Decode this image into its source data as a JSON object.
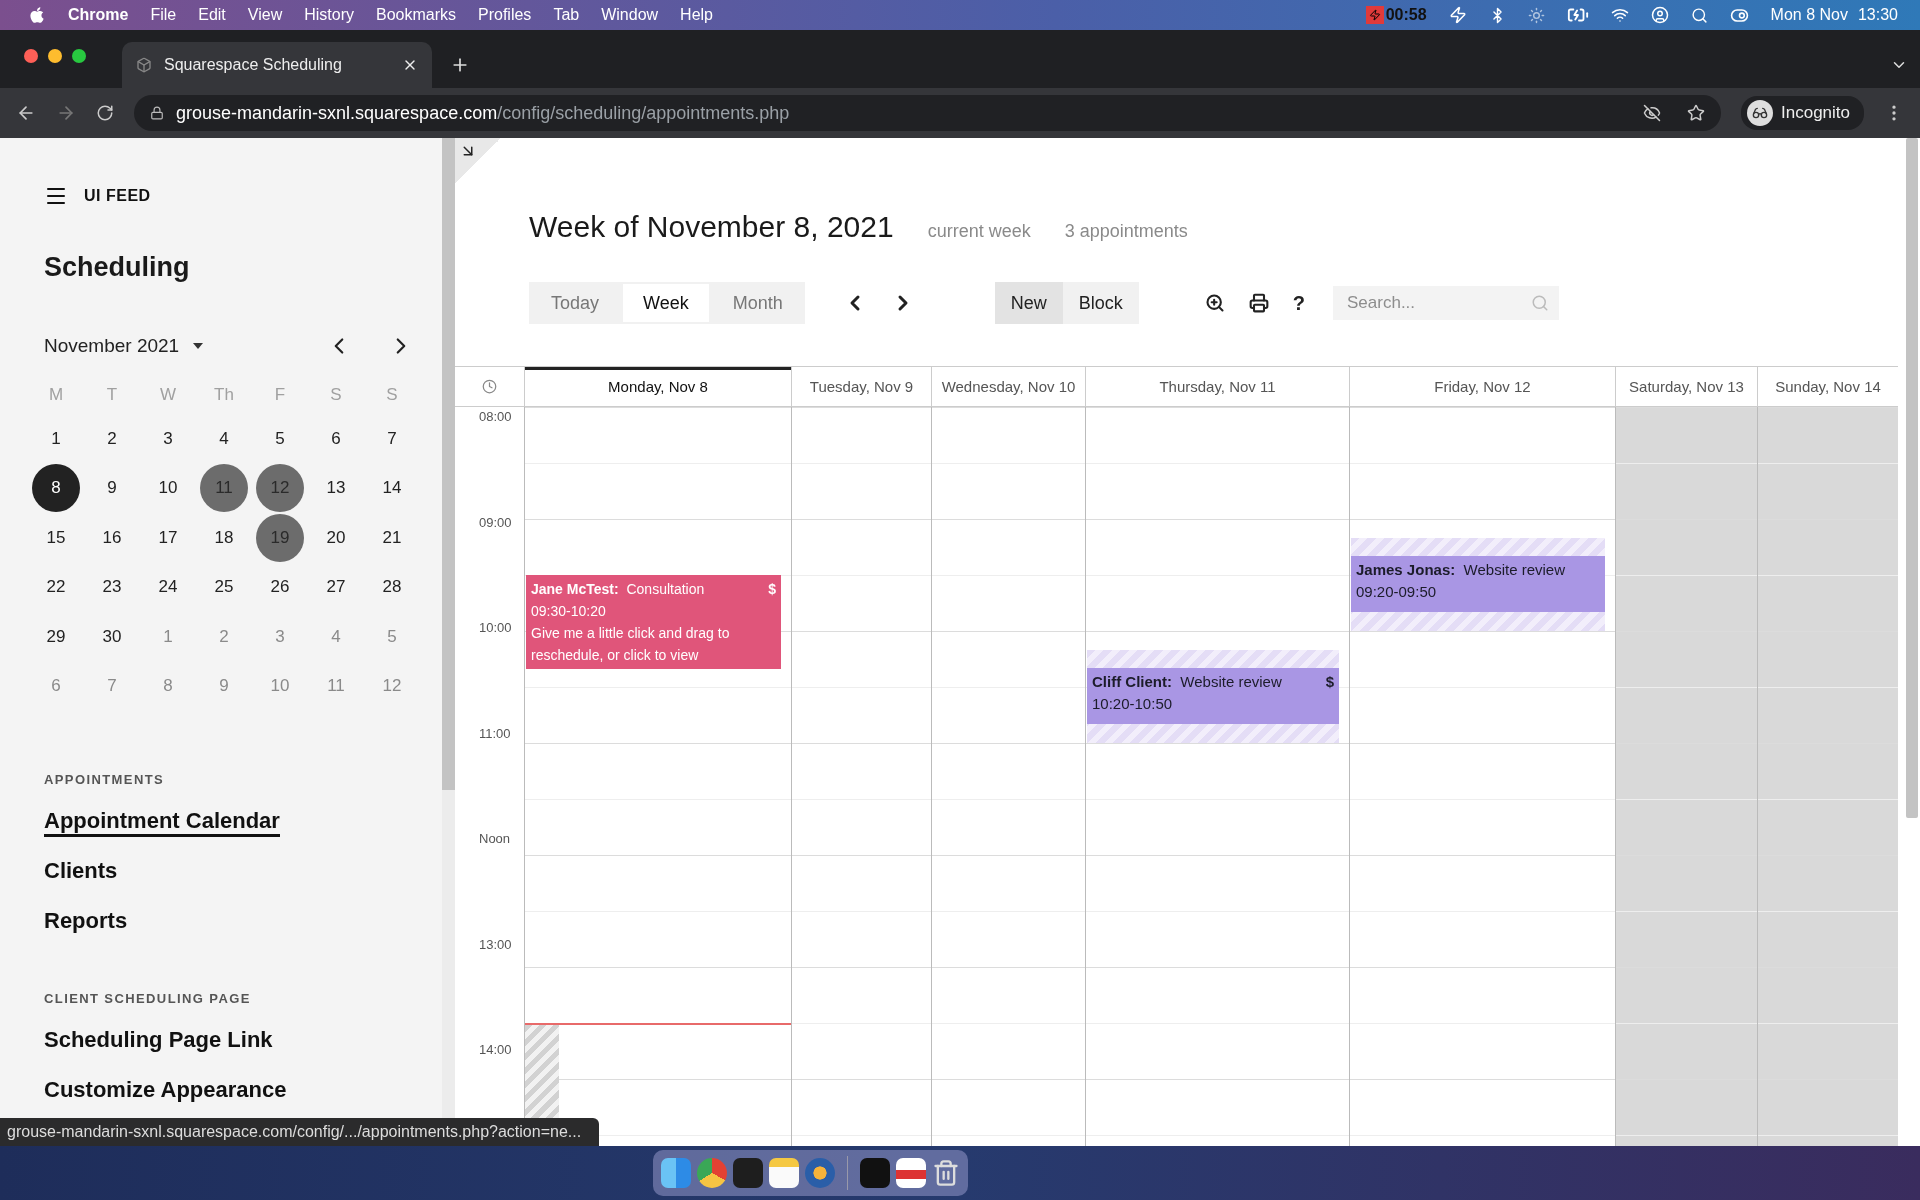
{
  "menubar": {
    "app": "Chrome",
    "menus": [
      "File",
      "Edit",
      "View",
      "History",
      "Bookmarks",
      "Profiles",
      "Tab",
      "Window",
      "Help"
    ],
    "timer": "00:58",
    "date": "Mon 8 Nov",
    "time": "13:30"
  },
  "browser": {
    "tab_title": "Squarespace Scheduling",
    "url_host": "grouse-mandarin-sxnl.squarespace.com",
    "url_path": "/config/scheduling/appointments.php",
    "profile": "Incognito"
  },
  "sidebar": {
    "brand": "UI FEED",
    "title": "Scheduling",
    "month": "November 2021",
    "weekdays": [
      "M",
      "T",
      "W",
      "Th",
      "F",
      "S",
      "S"
    ],
    "days": [
      {
        "label": "1",
        "outside": false,
        "selected": false,
        "marked": false
      },
      {
        "label": "2",
        "outside": false,
        "selected": false,
        "marked": false
      },
      {
        "label": "3",
        "outside": false,
        "selected": false,
        "marked": false
      },
      {
        "label": "4",
        "outside": false,
        "selected": false,
        "marked": false
      },
      {
        "label": "5",
        "outside": false,
        "selected": false,
        "marked": false
      },
      {
        "label": "6",
        "outside": false,
        "selected": false,
        "marked": false
      },
      {
        "label": "7",
        "outside": false,
        "selected": false,
        "marked": false
      },
      {
        "label": "8",
        "outside": false,
        "selected": true,
        "marked": false
      },
      {
        "label": "9",
        "outside": false,
        "selected": false,
        "marked": false
      },
      {
        "label": "10",
        "outside": false,
        "selected": false,
        "marked": false
      },
      {
        "label": "11",
        "outside": false,
        "selected": false,
        "marked": true
      },
      {
        "label": "12",
        "outside": false,
        "selected": false,
        "marked": true
      },
      {
        "label": "13",
        "outside": false,
        "selected": false,
        "marked": false
      },
      {
        "label": "14",
        "outside": false,
        "selected": false,
        "marked": false
      },
      {
        "label": "15",
        "outside": false,
        "selected": false,
        "marked": false
      },
      {
        "label": "16",
        "outside": false,
        "selected": false,
        "marked": false
      },
      {
        "label": "17",
        "outside": false,
        "selected": false,
        "marked": false
      },
      {
        "label": "18",
        "outside": false,
        "selected": false,
        "marked": false
      },
      {
        "label": "19",
        "outside": false,
        "selected": false,
        "marked": true
      },
      {
        "label": "20",
        "outside": false,
        "selected": false,
        "marked": false
      },
      {
        "label": "21",
        "outside": false,
        "selected": false,
        "marked": false
      },
      {
        "label": "22",
        "outside": false,
        "selected": false,
        "marked": false
      },
      {
        "label": "23",
        "outside": false,
        "selected": false,
        "marked": false
      },
      {
        "label": "24",
        "outside": false,
        "selected": false,
        "marked": false
      },
      {
        "label": "25",
        "outside": false,
        "selected": false,
        "marked": false
      },
      {
        "label": "26",
        "outside": false,
        "selected": false,
        "marked": false
      },
      {
        "label": "27",
        "outside": false,
        "selected": false,
        "marked": false
      },
      {
        "label": "28",
        "outside": false,
        "selected": false,
        "marked": false
      },
      {
        "label": "29",
        "outside": false,
        "selected": false,
        "marked": false
      },
      {
        "label": "30",
        "outside": false,
        "selected": false,
        "marked": false
      },
      {
        "label": "1",
        "outside": true,
        "selected": false,
        "marked": false
      },
      {
        "label": "2",
        "outside": true,
        "selected": false,
        "marked": false
      },
      {
        "label": "3",
        "outside": true,
        "selected": false,
        "marked": false
      },
      {
        "label": "4",
        "outside": true,
        "selected": false,
        "marked": false
      },
      {
        "label": "5",
        "outside": true,
        "selected": false,
        "marked": false
      },
      {
        "label": "6",
        "outside": true,
        "selected": false,
        "marked": false
      },
      {
        "label": "7",
        "outside": true,
        "selected": false,
        "marked": false
      },
      {
        "label": "8",
        "outside": true,
        "selected": false,
        "marked": false
      },
      {
        "label": "9",
        "outside": true,
        "selected": false,
        "marked": false
      },
      {
        "label": "10",
        "outside": true,
        "selected": false,
        "marked": false
      },
      {
        "label": "11",
        "outside": true,
        "selected": false,
        "marked": false
      },
      {
        "label": "12",
        "outside": true,
        "selected": false,
        "marked": false
      }
    ],
    "sections": [
      {
        "heading": "APPOINTMENTS",
        "items": [
          {
            "label": "Appointment Calendar",
            "selected": true
          },
          {
            "label": "Clients",
            "selected": false
          },
          {
            "label": "Reports",
            "selected": false
          }
        ]
      },
      {
        "heading": "CLIENT SCHEDULING PAGE",
        "items": [
          {
            "label": "Scheduling Page Link",
            "selected": false
          },
          {
            "label": "Customize Appearance",
            "selected": false
          }
        ]
      }
    ]
  },
  "main": {
    "title": "Week of November 8, 2021",
    "subtitle": "current week",
    "count": "3 appointments",
    "views": [
      {
        "label": "Today",
        "selected": false
      },
      {
        "label": "Week",
        "selected": true
      },
      {
        "label": "Month",
        "selected": false
      }
    ],
    "actions": [
      {
        "label": "New",
        "selected": true
      },
      {
        "label": "Block",
        "selected": false
      }
    ],
    "help": "?",
    "search": {
      "placeholder": "Search..."
    }
  },
  "calendar": {
    "days": [
      {
        "label": "Monday, Nov 8",
        "selected": true,
        "weekend": false,
        "appointments": [
          {
            "client": "Jane McTest:",
            "service": "Consultation",
            "time": "09:30-10:20",
            "paid": true,
            "buffered": false,
            "color": "#e0557a",
            "note": "Give me a little click and drag to reschedule, or click to view"
          }
        ]
      },
      {
        "label": "Tuesday, Nov 9",
        "selected": false,
        "weekend": false
      },
      {
        "label": "Wednesday, Nov 10",
        "selected": false,
        "weekend": false
      },
      {
        "label": "Thursday, Nov 11",
        "selected": false,
        "weekend": false,
        "appointments": [
          {
            "client": "Cliff Client:",
            "service": "Website review",
            "time": "10:20-10:50",
            "paid": true,
            "buffered": true,
            "color": "#a996e4"
          }
        ]
      },
      {
        "label": "Friday, Nov 12",
        "selected": false,
        "weekend": false,
        "appointments": [
          {
            "client": "James Jonas:",
            "service": "Website review",
            "time": "09:20-09:50",
            "paid": false,
            "buffered": true,
            "color": "#a996e4"
          }
        ]
      },
      {
        "label": "Saturday, Nov 13",
        "selected": false,
        "weekend": true
      },
      {
        "label": "Sunday, Nov 14",
        "selected": false,
        "weekend": true
      }
    ],
    "times": [
      "08:00",
      "09:00",
      "10:00",
      "11:00",
      "Noon",
      "13:00",
      "14:00"
    ],
    "paid_mark": "$"
  },
  "status_link": "grouse-mandarin-sxnl.squarespace.com/config/.../appointments.php?action=ne..."
}
